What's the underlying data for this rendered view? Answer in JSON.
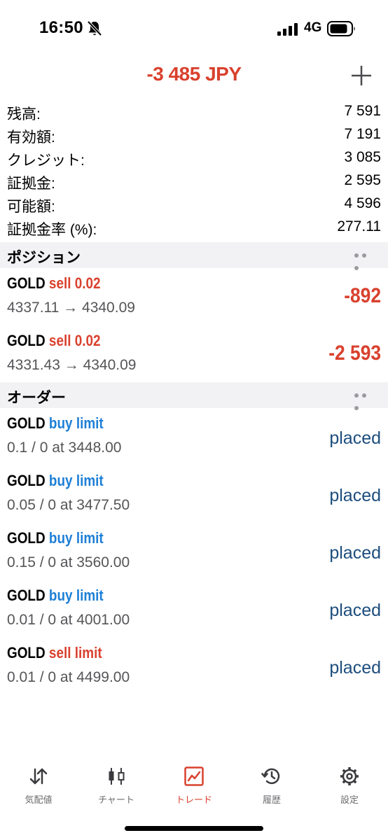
{
  "status_bar": {
    "time": "16:50",
    "network": "4G"
  },
  "header": {
    "title": "-3 485 JPY"
  },
  "summary": [
    {
      "label": "残高:",
      "value": "7 591"
    },
    {
      "label": "有効額:",
      "value": "7 191"
    },
    {
      "label": "クレジット:",
      "value": "3 085"
    },
    {
      "label": "証拠金:",
      "value": "2 595"
    },
    {
      "label": "可能額:",
      "value": "4 596"
    },
    {
      "label": "証拠金率 (%):",
      "value": "277.11"
    }
  ],
  "positions": {
    "title": "ポジション",
    "items": [
      {
        "symbol": "GOLD",
        "side": "sell 0.02",
        "prices": "4337.11 → 4340.09",
        "profit": "-892"
      },
      {
        "symbol": "GOLD",
        "side": "sell 0.02",
        "prices": "4331.43 → 4340.09",
        "profit": "-2 593"
      }
    ]
  },
  "orders": {
    "title": "オーダー",
    "items": [
      {
        "symbol": "GOLD",
        "side": "buy limit",
        "side_type": "buy",
        "details": "0.1 / 0 at 3448.00",
        "status": "placed"
      },
      {
        "symbol": "GOLD",
        "side": "buy limit",
        "side_type": "buy",
        "details": "0.05 / 0 at 3477.50",
        "status": "placed"
      },
      {
        "symbol": "GOLD",
        "side": "buy limit",
        "side_type": "buy",
        "details": "0.15 / 0 at 3560.00",
        "status": "placed"
      },
      {
        "symbol": "GOLD",
        "side": "buy limit",
        "side_type": "buy",
        "details": "0.01 / 0 at 4001.00",
        "status": "placed"
      },
      {
        "symbol": "GOLD",
        "side": "sell limit",
        "side_type": "sell",
        "details": "0.01 / 0 at 4499.00",
        "status": "placed"
      }
    ]
  },
  "tabs": [
    {
      "label": "気配値",
      "icon": "quotes-arrows-icon"
    },
    {
      "label": "チャート",
      "icon": "candlestick-icon"
    },
    {
      "label": "トレード",
      "icon": "trade-chart-icon",
      "active": true
    },
    {
      "label": "履歴",
      "icon": "history-clock-icon"
    },
    {
      "label": "設定",
      "icon": "gear-icon"
    }
  ],
  "colors": {
    "loss": "#d9412e",
    "buy": "#1e7fd6",
    "status": "#1d4d7d",
    "section_bg": "#f2f2f4"
  }
}
